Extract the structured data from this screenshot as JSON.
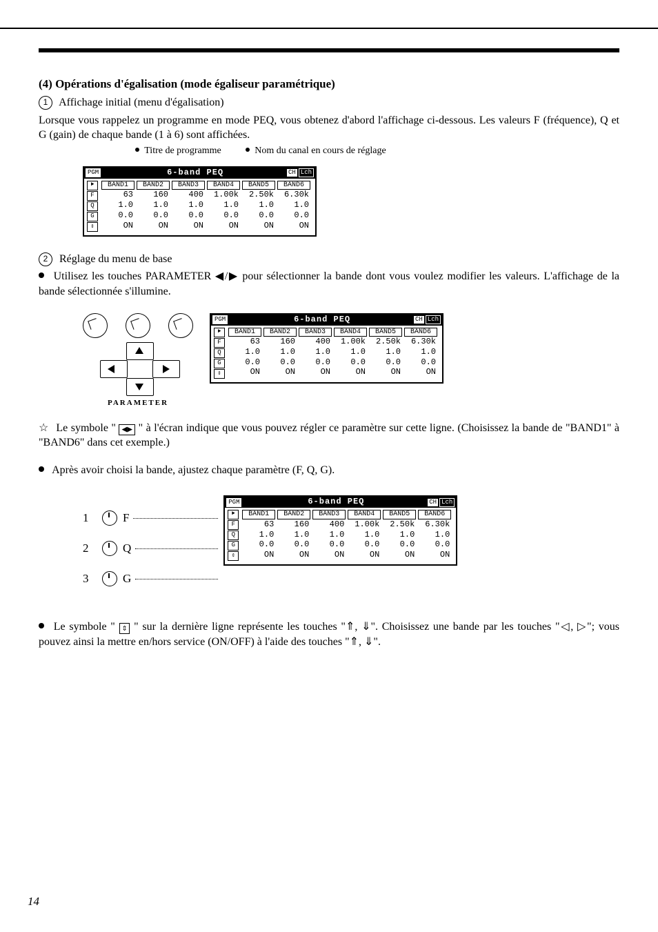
{
  "page_number": "14",
  "section": {
    "heading": "(4) Opérations d'égalisation (mode égaliseur paramétrique)",
    "step1_label": "1",
    "step1_title": "Affichage initial (menu d'égalisation)",
    "step1_body": "Lorsque vous rappelez un programme en mode PEQ, vous obtenez d'abord l'affichage ci-dessous. Les valeurs F (fréquence), Q et G (gain) de chaque bande (1 à 6) sont affichées.",
    "callout_left": "Titre de programme",
    "callout_right": "Nom du canal en cours de réglage",
    "step2_label": "2",
    "step2_title": "Réglage du menu de base",
    "step2_body": "Utilisez les touches PARAMETER ◀/▶ pour sélectionner la bande dont vous voulez modifier les valeurs. L'affichage de la bande sélectionnée s'illumine.",
    "star_note_a": "Le symbole \"",
    "star_note_b": "\" à l'écran indique que vous pouvez régler ce paramètre sur cette ligne. (Choisissez la bande de \"BAND1\" à \"BAND6\" dans cet exemple.)",
    "after_band": "Après avoir choisi la bande, ajustez chaque paramètre (F, Q, G).",
    "knob_labels": {
      "f": "F",
      "q": "Q",
      "g": "G"
    },
    "updown_note": "Le symbole \"",
    "updown_glyph": "⇕",
    "updown_note_b": "\" sur la dernière ligne représente les touches \"⇑, ⇓\". Choisissez une bande par les touches \"◁, ▷\"; vous pouvez ainsi la mettre en/hors service (ON/OFF) à l'aide des touches \"⇑, ⇓\"."
  },
  "lcd": {
    "pgm": "PGM",
    "title": "6-band PEQ",
    "ch": "CH",
    "chval": "Lch",
    "side": [
      "①",
      "②",
      "③",
      "⇕"
    ],
    "side_letters": [
      "F",
      "Q",
      "G"
    ],
    "headers": [
      "BAND1",
      "BAND2",
      "BAND3",
      "BAND4",
      "BAND5",
      "BAND6"
    ],
    "rows": {
      "F": [
        "63",
        "160",
        "400",
        "1.00k",
        "2.50k",
        "6.30k"
      ],
      "Q": [
        "1.0",
        "1.0",
        "1.0",
        "1.0",
        "1.0",
        "1.0"
      ],
      "G": [
        "0.0",
        "0.0",
        "0.0",
        "0.0",
        "0.0",
        "0.0"
      ],
      "ON": [
        "ON",
        "ON",
        "ON",
        "ON",
        "ON",
        "ON"
      ]
    }
  },
  "pad_label": "PARAMETER",
  "arrow_glyph": "◀▶"
}
